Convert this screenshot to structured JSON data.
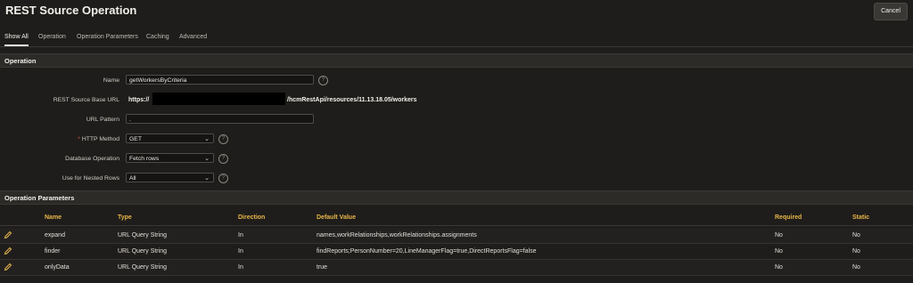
{
  "header": {
    "title": "REST Source Operation",
    "cancel_label": "Cancel"
  },
  "tabs": [
    "Show All",
    "Operation",
    "Operation Parameters",
    "Caching",
    "Advanced"
  ],
  "operation": {
    "section_title": "Operation",
    "name_label": "Name",
    "name_value": "getWorkersByCriteria",
    "base_url_label": "REST Source Base URL",
    "base_url_prefix": "https://",
    "base_url_suffix": "/hcmRestApi/resources/11.13.18.05/workers",
    "url_pattern_label": "URL Pattern",
    "url_pattern_value": ".",
    "http_method_label": "HTTP Method",
    "http_method_value": "GET",
    "db_operation_label": "Database Operation",
    "db_operation_value": "Fetch rows",
    "nested_rows_label": "Use for Nested Rows",
    "nested_rows_value": "All"
  },
  "params": {
    "section_title": "Operation Parameters",
    "columns": [
      "Name",
      "Type",
      "Direction",
      "Default Value",
      "Required",
      "Static"
    ],
    "rows": [
      {
        "name": "expand",
        "type": "URL Query String",
        "direction": "In",
        "default": "names,workRelationships,workRelationships.assignments",
        "required": "No",
        "static": "No"
      },
      {
        "name": "finder",
        "type": "URL Query String",
        "direction": "In",
        "default": "findReports;PersonNumber=20,LineManagerFlag=true,DirectReportsFlag=false",
        "required": "No",
        "static": "No"
      },
      {
        "name": "onlyData",
        "type": "URL Query String",
        "direction": "In",
        "default": "true",
        "required": "No",
        "static": "No"
      }
    ]
  }
}
